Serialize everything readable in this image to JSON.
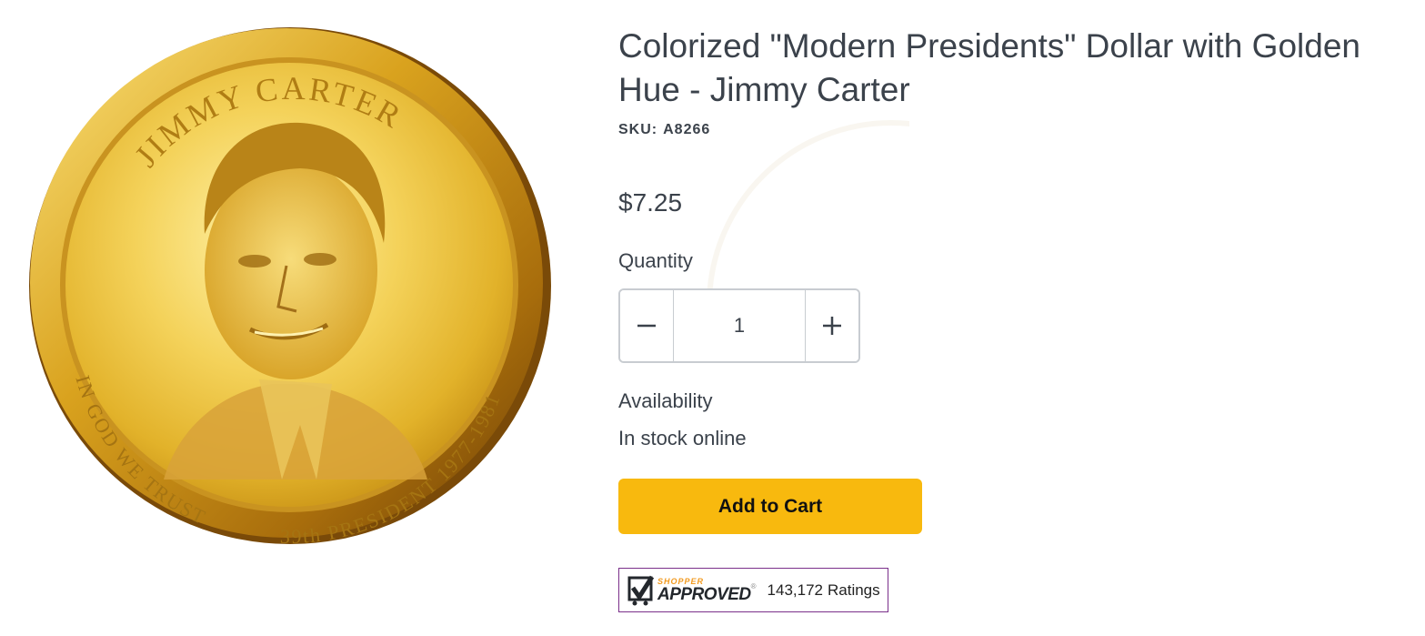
{
  "product": {
    "title": "Colorized \"Modern Presidents\" Dollar with Golden Hue - Jimmy Carter",
    "sku_label": "SKU:",
    "sku_value": "A8266",
    "price": "$7.25",
    "image": {
      "top_legend": "JIMMY CARTER",
      "bottom_legend_left": "IN GOD WE TRUST",
      "bottom_legend_right": "39th PRESIDENT 1977-1981"
    }
  },
  "quantity": {
    "label": "Quantity",
    "value": "1",
    "decrement_symbol": "minus-icon",
    "increment_symbol": "plus-icon"
  },
  "availability": {
    "label": "Availability",
    "value": "In stock online"
  },
  "cart": {
    "button_label": "Add to Cart",
    "button_color": "#f8b90e"
  },
  "rating_badge": {
    "brand_top": "SHOPPER",
    "brand_bottom": "APPROVED",
    "registered": "®",
    "count": "143,172",
    "count_label": "Ratings"
  }
}
